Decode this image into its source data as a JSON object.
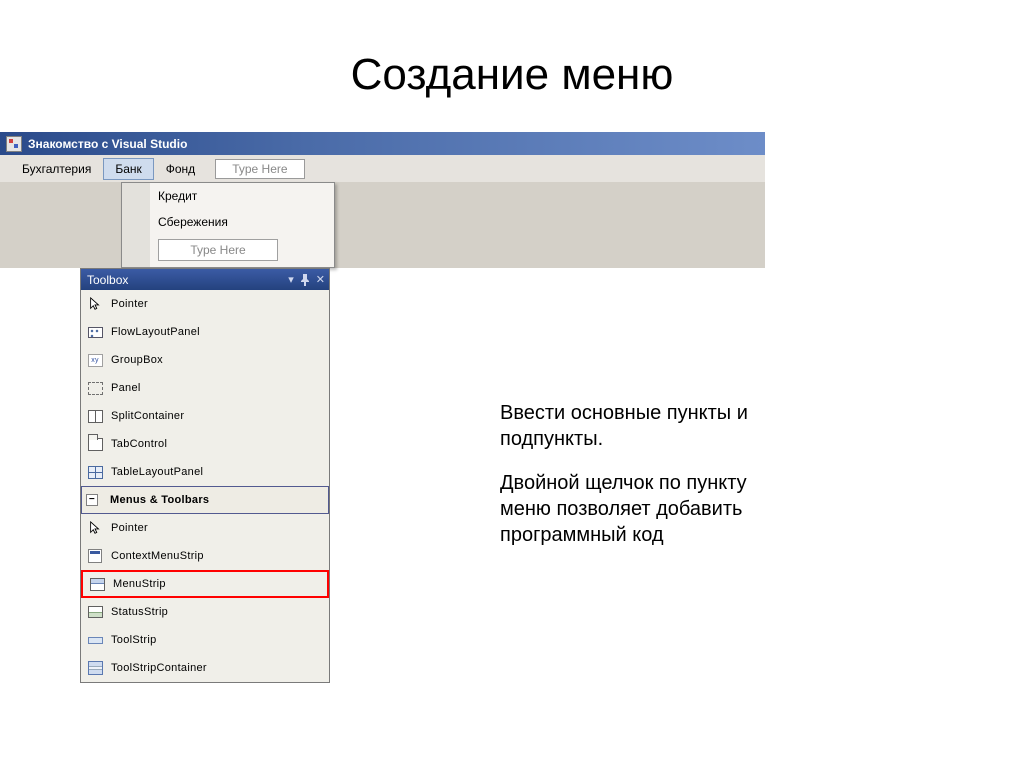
{
  "slide": {
    "title": "Создание меню"
  },
  "vs": {
    "title": "Знакомство с Visual Studio",
    "menubar": {
      "items": [
        "Бухгалтерия",
        "Банк",
        "Фонд"
      ],
      "active_index": 1,
      "type_here": "Type Here"
    },
    "dropdown": {
      "items": [
        "Кредит",
        "Сбережения"
      ],
      "type_here": "Type Here"
    }
  },
  "toolbox": {
    "title": "Toolbox",
    "groups": [
      {
        "items": [
          {
            "icon": "pointer",
            "label": "Pointer"
          },
          {
            "icon": "flow",
            "label": "FlowLayoutPanel"
          },
          {
            "icon": "xy",
            "label": "GroupBox"
          },
          {
            "icon": "dashed",
            "label": "Panel"
          },
          {
            "icon": "split",
            "label": "SplitContainer"
          },
          {
            "icon": "tab",
            "label": "TabControl"
          },
          {
            "icon": "grid",
            "label": "TableLayoutPanel"
          }
        ]
      },
      {
        "category": "Menus & Toolbars",
        "items": [
          {
            "icon": "pointer",
            "label": "Pointer"
          },
          {
            "icon": "context",
            "label": "ContextMenuStrip"
          },
          {
            "icon": "menustrip",
            "label": "MenuStrip",
            "selected": true
          },
          {
            "icon": "status",
            "label": "StatusStrip"
          },
          {
            "icon": "toolstrip",
            "label": "ToolStrip"
          },
          {
            "icon": "container",
            "label": "ToolStripContainer"
          }
        ]
      }
    ]
  },
  "body": {
    "p1": "Ввести основные пункты и подпункты.",
    "p2": "Двойной щелчок по пункту меню позволяет добавить программный код"
  }
}
